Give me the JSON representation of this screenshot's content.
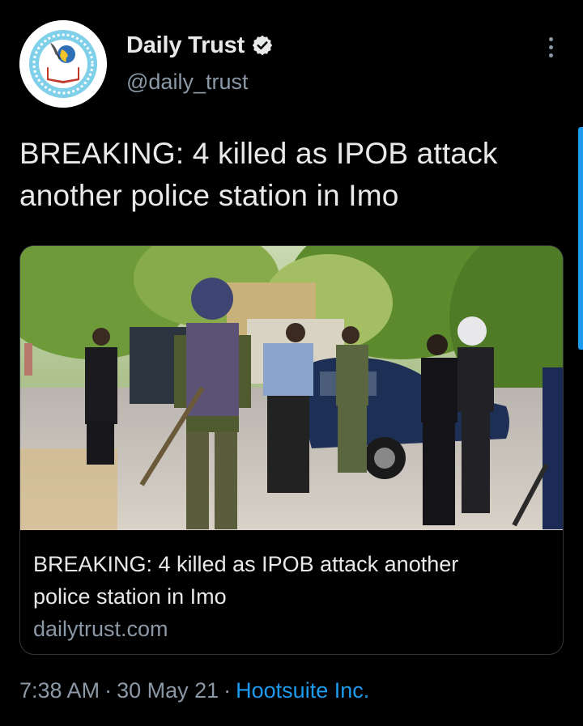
{
  "tweet": {
    "author": {
      "display_name": "Daily Trust",
      "handle": "@daily_trust",
      "verified": true,
      "avatar_icon": "daily-trust-logo",
      "verified_icon": "verified-badge-icon"
    },
    "more_icon": "more-vertical-icon",
    "text_line1": "BREAKING: 4 killed as IPOB attack",
    "text_line2": "another police station in Imo",
    "card": {
      "image_description_icon": "police-officers-photo",
      "title_line1": "BREAKING: 4 killed as IPOB attack another",
      "title_line2": "police station in Imo",
      "domain": "dailytrust.com"
    },
    "meta": {
      "time": "7:38 AM",
      "separator": "·",
      "date": "30 May 21",
      "source": "Hootsuite Inc."
    }
  },
  "colors": {
    "background": "#000000",
    "primary_text": "#e7e9ea",
    "secondary_text": "#8b98a5",
    "link": "#1d9bf0",
    "border": "#333639"
  }
}
